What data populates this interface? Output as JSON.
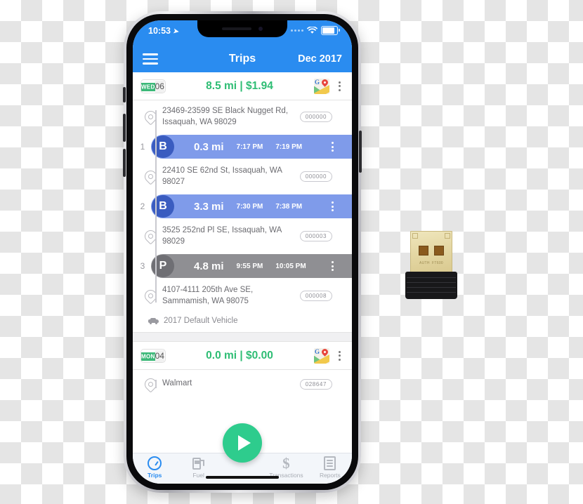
{
  "status_bar": {
    "time": "10:53",
    "location_arrow_icon": "location-arrow-icon",
    "signal_icon": "signal-dots-icon",
    "wifi_icon": "wifi-icon",
    "battery_icon": "battery-full-icon"
  },
  "nav": {
    "menu_icon": "hamburger-menu-icon",
    "title": "Trips",
    "month": "Dec 2017"
  },
  "colors": {
    "header_blue": "#2a8cf0",
    "total_green": "#2ebd74",
    "badge_green": "#3cb878",
    "business_blue": "#7f9bea",
    "business_circle": "#3a5cc0",
    "personal_gray": "#8f8f93",
    "personal_circle": "#6f6f74",
    "fab_green": "#2ecc8d"
  },
  "days": [
    {
      "dow": "WED",
      "day": "06",
      "total": "8.5 mi | $1.94",
      "maps_icon": "google-maps-icon",
      "menu_icon": "kebab-menu-icon",
      "vehicle": "2017 Default Vehicle",
      "vehicle_icon": "car-icon",
      "entries": [
        {
          "kind": "stop",
          "address": "23469-23599 SE Black Nugget Rd, Issaquah, WA 98029",
          "odometer": "000000"
        },
        {
          "kind": "trip",
          "index": "1",
          "type": "B",
          "style": "b",
          "distance": "0.3 mi",
          "start_time": "7:17 PM",
          "end_time": "7:19 PM"
        },
        {
          "kind": "stop",
          "address": "22410 SE 62nd St, Issaquah, WA 98027",
          "odometer": "000000"
        },
        {
          "kind": "trip",
          "index": "2",
          "type": "B",
          "style": "b",
          "distance": "3.3 mi",
          "start_time": "7:30 PM",
          "end_time": "7:38 PM"
        },
        {
          "kind": "stop",
          "address": "3525 252nd Pl SE, Issaquah, WA 98029",
          "odometer": "000003"
        },
        {
          "kind": "trip",
          "index": "3",
          "type": "P",
          "style": "p",
          "distance": "4.8 mi",
          "start_time": "9:55 PM",
          "end_time": "10:05 PM"
        },
        {
          "kind": "stop",
          "address": "4107-4111 205th Ave SE, Sammamish, WA 98075",
          "odometer": "000008"
        }
      ]
    },
    {
      "dow": "MON",
      "day": "04",
      "total": "0.0 mi | $0.00",
      "maps_icon": "google-maps-icon",
      "menu_icon": "kebab-menu-icon",
      "entries": [
        {
          "kind": "stop",
          "address": "Walmart",
          "odometer": "028647"
        }
      ]
    }
  ],
  "fab": {
    "icon": "play-icon"
  },
  "tabs": [
    {
      "label": "Trips",
      "icon": "speedometer-icon",
      "active": true
    },
    {
      "label": "Fuel",
      "icon": "fuel-pump-icon",
      "active": false
    },
    {
      "label": "Transactions",
      "icon": "dollar-icon",
      "active": false
    },
    {
      "label": "Reports",
      "icon": "report-list-icon",
      "active": false
    }
  ],
  "dongle": {
    "name": "usb-nano-adapter",
    "mark_left": "AUTH",
    "mark_right": "FT600"
  }
}
